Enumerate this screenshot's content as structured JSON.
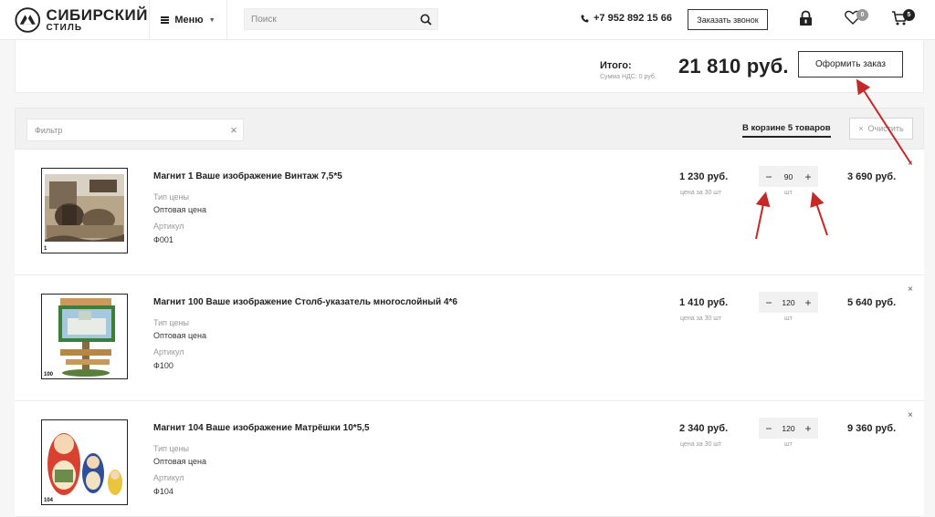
{
  "header": {
    "logo_line1": "СИБИРСКИЙ",
    "logo_line2": "СТИЛЬ",
    "menu_label": "Меню",
    "search_placeholder": "Поиск",
    "phone": "+7 952 892 15 66",
    "callback_label": "Заказать звонок",
    "favorites_count": "0",
    "cart_count": "5"
  },
  "summary": {
    "total_label": "Итого:",
    "vat_label": "Сумма НДС: 0 руб.",
    "total_sum": "21 810 руб.",
    "checkout_label": "Оформить заказ"
  },
  "filter": {
    "placeholder": "Фильтр",
    "cart_count_label": "В корзине 5 товаров",
    "clear_label": "Очистить"
  },
  "items": [
    {
      "number": "1",
      "title": "Магнит 1 Ваше изображение Винтаж 7,5*5",
      "price_type_label": "Тип цены",
      "price_type": "Оптовая цена",
      "sku_label": "Артикул",
      "sku": "Ф001",
      "price": "1 230 руб.",
      "price_note": "цена за 30 шт",
      "qty": "90",
      "unit": "шт",
      "total": "3 690 руб."
    },
    {
      "number": "100",
      "title": "Магнит 100 Ваше изображение Столб-указатель многослойный 4*6",
      "price_type_label": "Тип цены",
      "price_type": "Оптовая цена",
      "sku_label": "Артикул",
      "sku": "Ф100",
      "price": "1 410 руб.",
      "price_note": "цена за 30 шт",
      "qty": "120",
      "unit": "шт",
      "total": "5 640 руб."
    },
    {
      "number": "104",
      "title": "Магнит 104 Ваше изображение Матрёшки 10*5,5",
      "price_type_label": "Тип цены",
      "price_type": "Оптовая цена",
      "sku_label": "Артикул",
      "sku": "Ф104",
      "price": "2 340 руб.",
      "price_note": "цена за 30 шт",
      "qty": "120",
      "unit": "шт",
      "total": "9 360 руб."
    }
  ],
  "icons": {
    "minus": "−",
    "plus": "+",
    "remove": "×",
    "clear": "×"
  },
  "colors": {
    "accent": "#222222",
    "arrow": "#c62828",
    "badge": "#222222",
    "badge_muted": "#999999"
  }
}
